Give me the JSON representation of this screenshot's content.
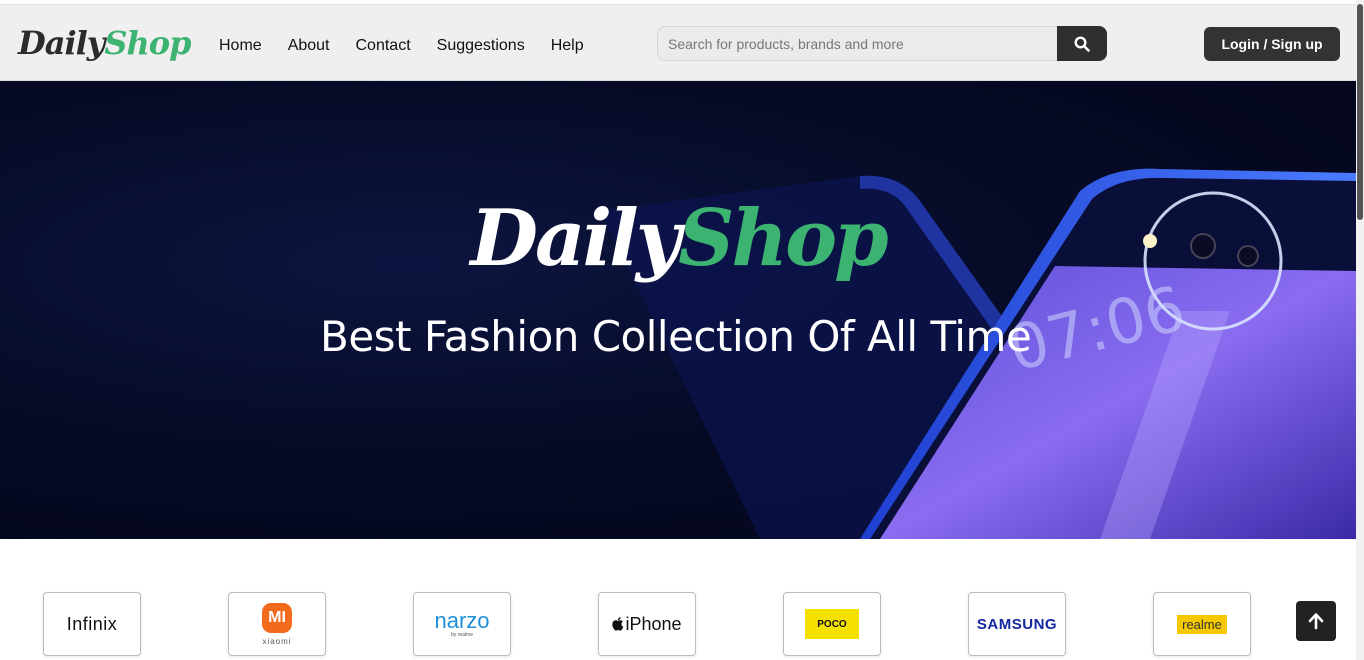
{
  "header": {
    "logo_part1": "Daily",
    "logo_part2": "Shop",
    "nav": [
      {
        "label": "Home"
      },
      {
        "label": "About"
      },
      {
        "label": "Contact"
      },
      {
        "label": "Suggestions"
      },
      {
        "label": "Help"
      }
    ],
    "search": {
      "placeholder": "Search for products, brands and more",
      "icon": "search-icon"
    },
    "login_label": "Login / Sign up"
  },
  "hero": {
    "logo_part1": "Daily",
    "logo_part2": "Shop",
    "tagline": "Best Fashion Collection Of All Time"
  },
  "brands": [
    {
      "name": "Infinix"
    },
    {
      "name": "MI",
      "sub": "xiaomi"
    },
    {
      "name": "narzo",
      "sub": "by realme"
    },
    {
      "name": "iPhone"
    },
    {
      "name": "POCO"
    },
    {
      "name": "SAMSUNG"
    },
    {
      "name": "realme"
    }
  ],
  "scroll_top_icon": "arrow-up-icon",
  "colors": {
    "accent": "#3cb371",
    "dark_button": "#333333",
    "navbar_bg": "#efefef"
  }
}
